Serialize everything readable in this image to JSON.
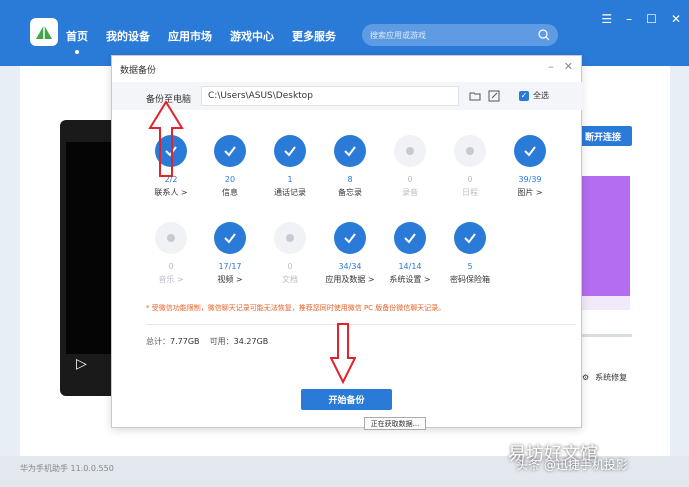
{
  "app": {
    "nav": [
      "首页",
      "我的设备",
      "应用市场",
      "游戏中心",
      "更多服务"
    ],
    "search_placeholder": "搜索应用或游戏",
    "status": "华为手机助手 11.0.0.550"
  },
  "right_panel": {
    "button": "断开连接",
    "sys_repair": "系统修复"
  },
  "dialog": {
    "title": "数据备份",
    "path_label": "备份至电脑",
    "path_value": "C:\\Users\\ASUS\\Desktop",
    "select_all": "全选",
    "items": [
      {
        "count": "2/2",
        "name": "联系人 >",
        "active": true
      },
      {
        "count": "20",
        "name": "信息",
        "active": true
      },
      {
        "count": "1",
        "name": "通话记录",
        "active": true
      },
      {
        "count": "8",
        "name": "备忘录",
        "active": true
      },
      {
        "count": "0",
        "name": "录音",
        "active": false
      },
      {
        "count": "0",
        "name": "日程",
        "active": false
      },
      {
        "count": "39/39",
        "name": "图片 >",
        "active": true
      },
      {
        "count": "0",
        "name": "音乐 >",
        "active": false
      },
      {
        "count": "17/17",
        "name": "视频 >",
        "active": true
      },
      {
        "count": "0",
        "name": "文档",
        "active": false
      },
      {
        "count": "34/34",
        "name": "应用及数据 >",
        "active": true
      },
      {
        "count": "14/14",
        "name": "系统设置 >",
        "active": true
      },
      {
        "count": "5",
        "name": "密码保险箱",
        "active": true
      }
    ],
    "notice": "* 受微信功能限制，微信聊天记录可能无法恢复，推荐您同时使用微信 PC 版备份微信聊天记录。",
    "storage_total_label": "总计：",
    "storage_total": "7.77GB",
    "storage_avail_label": "可用：",
    "storage_avail": "34.27GB",
    "start_button": "开始备份",
    "tooltip": "正在获取数据..."
  },
  "watermark": {
    "main": "易坊好文馆",
    "sub": "头条 @迅捷手机投影"
  },
  "colors": {
    "accent": "#2a7ad8",
    "annotation": "#e0242a"
  }
}
